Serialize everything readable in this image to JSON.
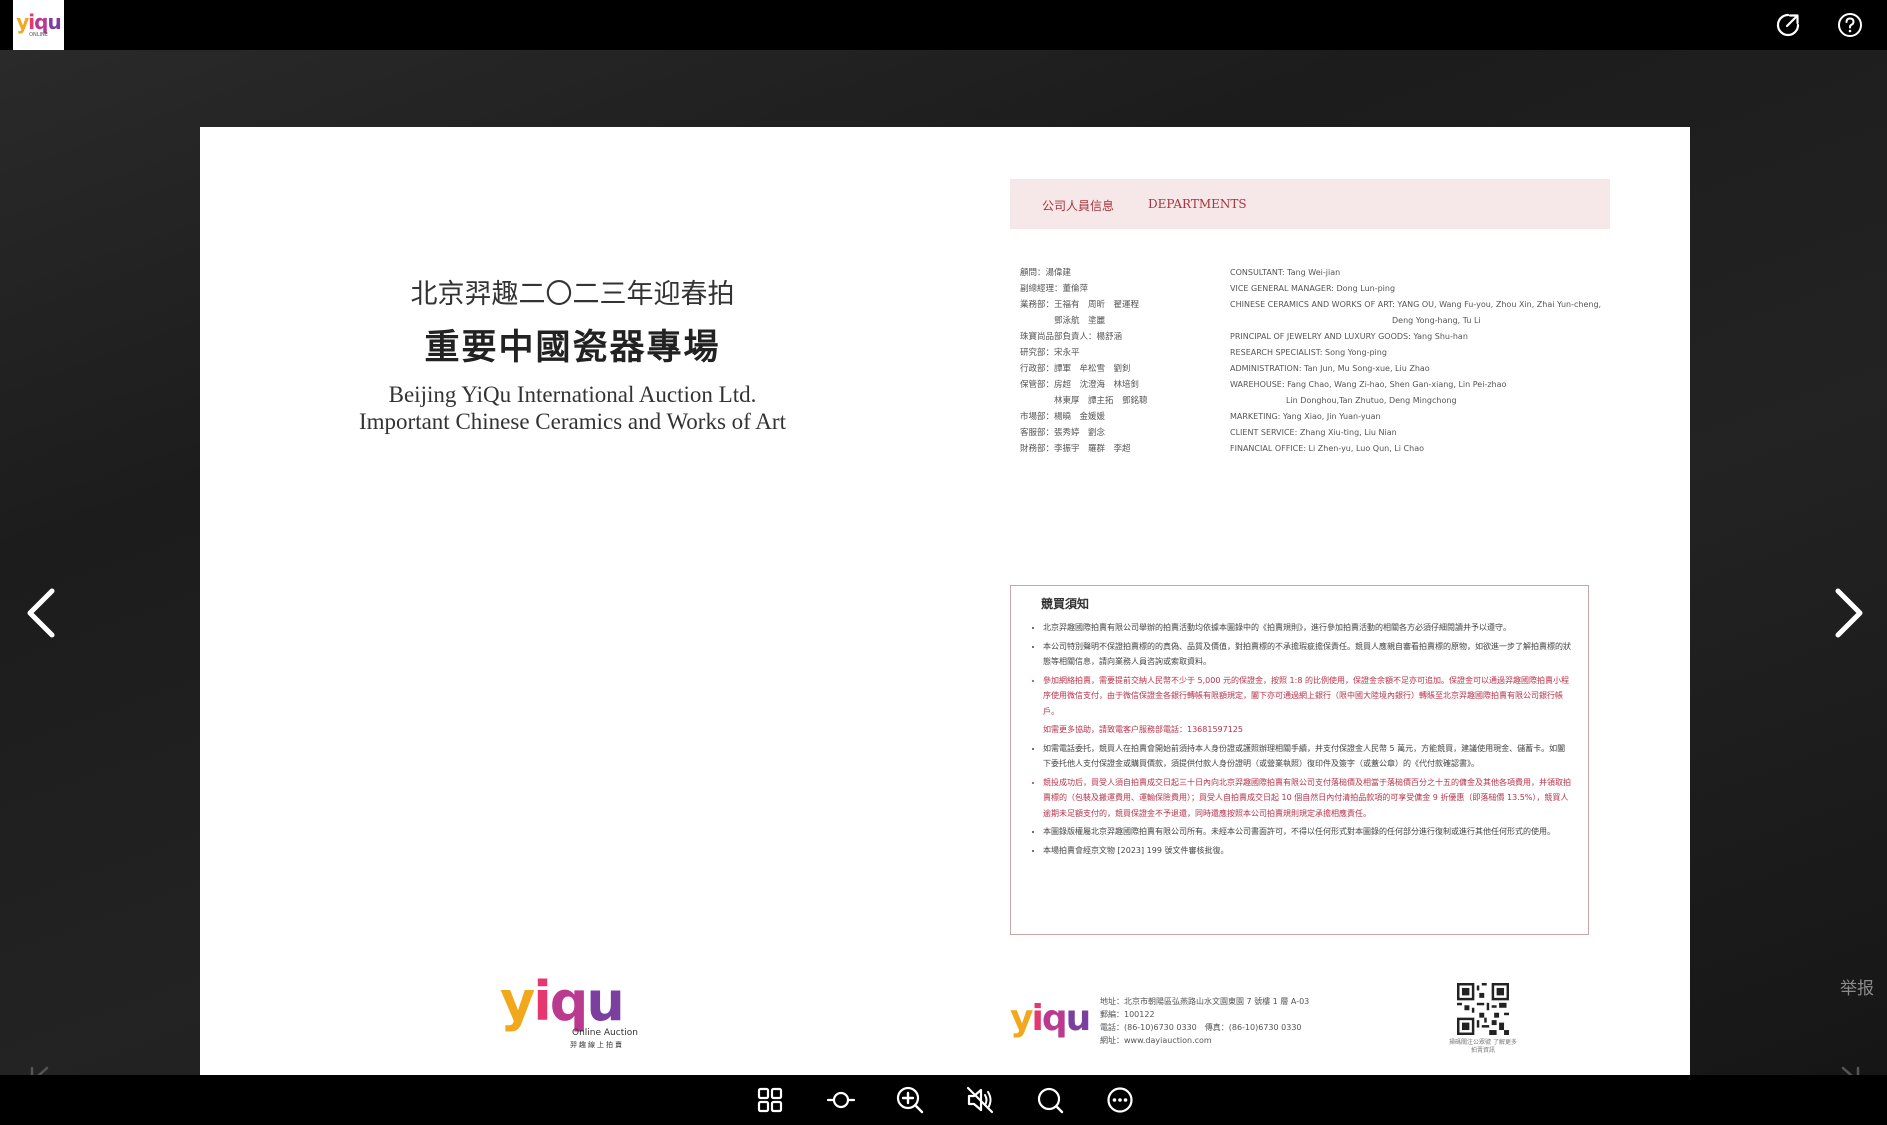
{
  "header": {
    "logo_text": "yiqu",
    "logo_sub": "ONLINE",
    "share_icon": "share-external-icon",
    "help_icon": "help-circle-icon"
  },
  "left_page": {
    "title_cn_line1": "北京羿趣二〇二三年迎春拍",
    "title_cn_line2": "重要中國瓷器專場",
    "title_en_line1": "Beijing YiQu International Auction Ltd.",
    "title_en_line2": "Important Chinese Ceramics and Works of Art",
    "logo_text": "yiqu",
    "logo_caption": "Online Auction",
    "logo_caption_cn": "羿趣線上拍賣"
  },
  "right_page": {
    "dept_header_cn": "公司人員信息",
    "dept_header_en": "DEPARTMENTS",
    "staff_cn": [
      "顧問：湯偉建",
      "副總經理：董倫萍",
      "業務部：王福有　周昕　翟運程",
      "　　　　鄧泳航　塗麗",
      "珠寶尚品部負責人：楊舒涵",
      "研究部：宋永平",
      "行政部：譚軍　牟松雪　劉釗",
      "保管部：房超　沈澄海　林培釗",
      "　　　　林東厚　譚主拓　鄧銘聰",
      "市場部：楊曉　金媛媛",
      "客服部：張秀婷　劉念",
      "財務部：李振宇　羅群　李超"
    ],
    "staff_en": [
      "CONSULTANT: Tang Wei-jian",
      "VICE GENERAL MANAGER: Dong Lun-ping",
      "CHINESE CERAMICS AND WORKS OF ART: YANG OU, Wang Fu-you, Zhou Xin, Zhai Yun-cheng,",
      "Deng Yong-hang, Tu Li",
      "PRINCIPAL OF JEWELRY AND LUXURY GOODS: Yang Shu-han",
      "RESEARCH SPECIALIST: Song Yong-ping",
      "ADMINISTRATION: Tan Jun, Mu Song-xue, Liu Zhao",
      "WAREHOUSE: Fang Chao, Wang Zi-hao, Shen Gan-xiang, Lin Pei-zhao",
      "Lin Donghou,Tan Zhutuo, Deng Mingchong",
      "MARKETING: Yang Xiao, Jin Yuan-yuan",
      "CLIENT SERVICE: Zhang Xiu-ting, Liu Nian",
      "FINANCIAL OFFICE: Li Zhen-yu, Luo Qun, Li Chao"
    ],
    "notice_title": "競買須知",
    "notice_items": [
      "北京羿趣國際拍賣有限公司舉辦的拍賣活動均依據本圖錄中的《拍賣規則》，進行參加拍賣活動的相關各方必須仔細閱讀并予以遵守。",
      "本公司特別聲明不保證拍賣標的的真偽、品質及價值，對拍賣標的不承擔瑕疵擔保責任。競買人應親自審看拍賣標的原物，如欲進一步了解拍賣標的狀態等相關信息，請向業務人員咨詢或索取資料。",
      "參加網絡拍賣，需要提前交納人民幣不少于 5,000 元的保證金，按照 1:8 的比例使用，保證金余額不足亦可追加。保證金可以通過羿趣國際拍賣小程序使用微信支付，由于微信保證金各銀行轉帳有限額規定，闔下亦可通過網上銀行（限中國大陸境內銀行）轉賬至北京羿趣國際拍賣有限公司銀行帳戶。",
      "如需更多協助，請致電客户服務部電話：13681597125",
      "如需電話委托，競買人在拍賣會開始前須持本人身份證或護照辦理相關手續，并支付保證金人民幣 5 萬元，方能競買，建議使用現金、儲蓄卡。如闔下委托他人支付保證金或購買價款，須提供付款人身份證明（或營業執照）復印件及簽字（或蓋公章）的《代付款確認書》。",
      "競投成功后，買受人須自拍賣成交日起三十日內向北京羿趣國際拍賣有限公司支付落槌價及相當于落槌價百分之十五的傭金及其他各項費用，并領取拍賣標的（包裝及搬運費用、運輸保險費用）；買受人自拍賣成交日起 10 個自然日內付清拍品款項的可享受傭金 9 折優惠（即落槌價 13.5%），競買人逾期未足額支付的，競買保證金不予退還，同時還應按照本公司拍賣規則規定承擔相應責任。",
      "本圖錄版權屬北京羿趣國際拍賣有限公司所有。未經本公司書面許可，不得以任何形式對本圖錄的任何部分進行復制或進行其他任何形式的使用。",
      "本場拍賣會經京文物 [2023] 199 號文件審核批復。"
    ],
    "footer_logo_text": "yiqu",
    "footer_address": [
      "地址：北京市朝陽區弘燕路山水文園東園 7 號樓 1 層 A-03",
      "郵編：100122",
      "電話：(86-10)6730 0330　傳真：(86-10)6730 0330",
      "網址：www.dayiauction.com"
    ],
    "qr_caption": "掃碼關注公眾號 了解更多拍賣資訊"
  },
  "viewer": {
    "report_label": "举报",
    "prev_icon": "chevron-left-icon",
    "next_icon": "chevron-right-icon",
    "first_icon": "first-page-icon",
    "last_icon": "last-page-icon"
  },
  "toolbar": {
    "icons": [
      "thumbnails-icon",
      "autoplay-icon",
      "zoom-in-icon",
      "sound-mute-icon",
      "search-icon",
      "more-icon"
    ]
  }
}
